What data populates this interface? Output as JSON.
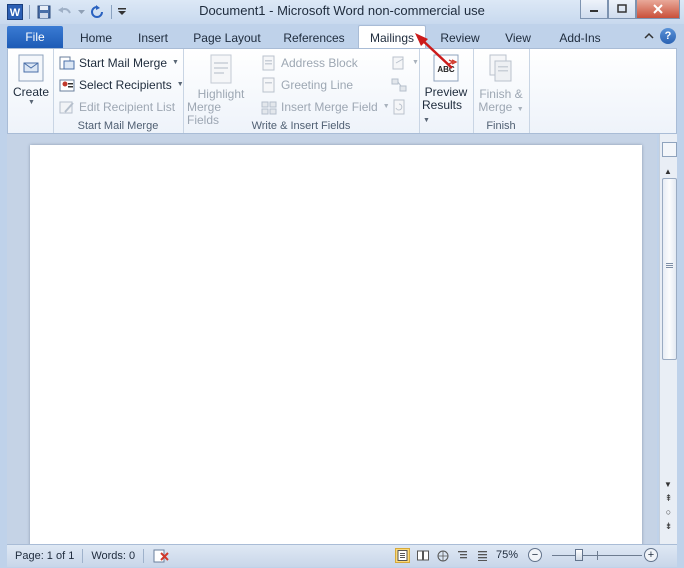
{
  "window": {
    "title": "Document1 - Microsoft Word non-commercial use",
    "icon_label": "W"
  },
  "tabs": {
    "file": "File",
    "items": [
      "Home",
      "Insert",
      "Page Layout",
      "References",
      "Mailings",
      "Review",
      "View",
      "Add-Ins"
    ],
    "active": "Mailings"
  },
  "ribbon": {
    "create": {
      "label": "Create"
    },
    "start_mail_merge_group": {
      "label": "Start Mail Merge",
      "start_mail_merge": "Start Mail Merge",
      "select_recipients": "Select Recipients",
      "edit_recipient_list": "Edit Recipient List"
    },
    "write_insert_group": {
      "label": "Write & Insert Fields",
      "highlight_line1": "Highlight",
      "highlight_line2": "Merge Fields",
      "address_block": "Address Block",
      "greeting_line": "Greeting Line",
      "insert_merge_field": "Insert Merge Field"
    },
    "preview_group": {
      "preview_line1": "Preview",
      "preview_line2": "Results",
      "icon_text": "ABC"
    },
    "finish_group": {
      "label": "Finish",
      "finish_line1": "Finish &",
      "finish_line2": "Merge"
    }
  },
  "statusbar": {
    "page": "Page: 1 of 1",
    "words": "Words: 0",
    "zoom": "75%",
    "zoom_level_percent": 75
  },
  "colors": {
    "file_tab": "#1d5bb6",
    "annotation_arrow": "#cc1b1b",
    "active_view": "#fbd979"
  }
}
